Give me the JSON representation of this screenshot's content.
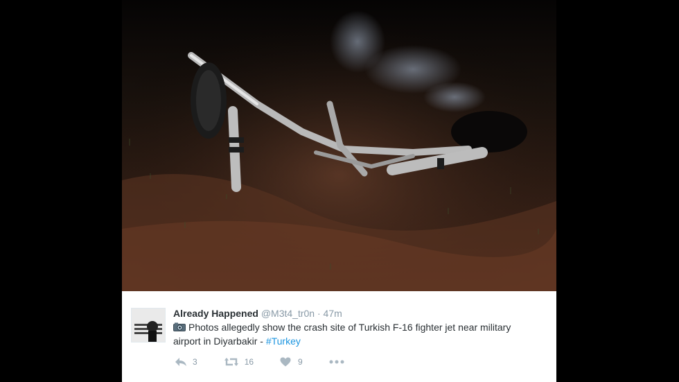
{
  "photo": {
    "icon": "crash-wreckage-photo"
  },
  "tweet": {
    "display_name": "Already Happened",
    "username": "@M3t4_tr0n",
    "separator": "·",
    "time": "47m",
    "text_main": "Photos allegedly show the crash site of Turkish F-16 fighter jet near military airport in Diyarbakir - ",
    "hashtag": "#Turkey",
    "camera_icon": "camera-emoji-icon",
    "actions": {
      "reply_icon": "reply-icon",
      "reply_count": "3",
      "retweet_icon": "retweet-icon",
      "retweet_count": "16",
      "like_icon": "heart-icon",
      "like_count": "9",
      "more_icon": "more-dots-icon"
    },
    "colors": {
      "name": "#292f33",
      "meta": "#8899a6",
      "link": "#1b95e0"
    }
  }
}
